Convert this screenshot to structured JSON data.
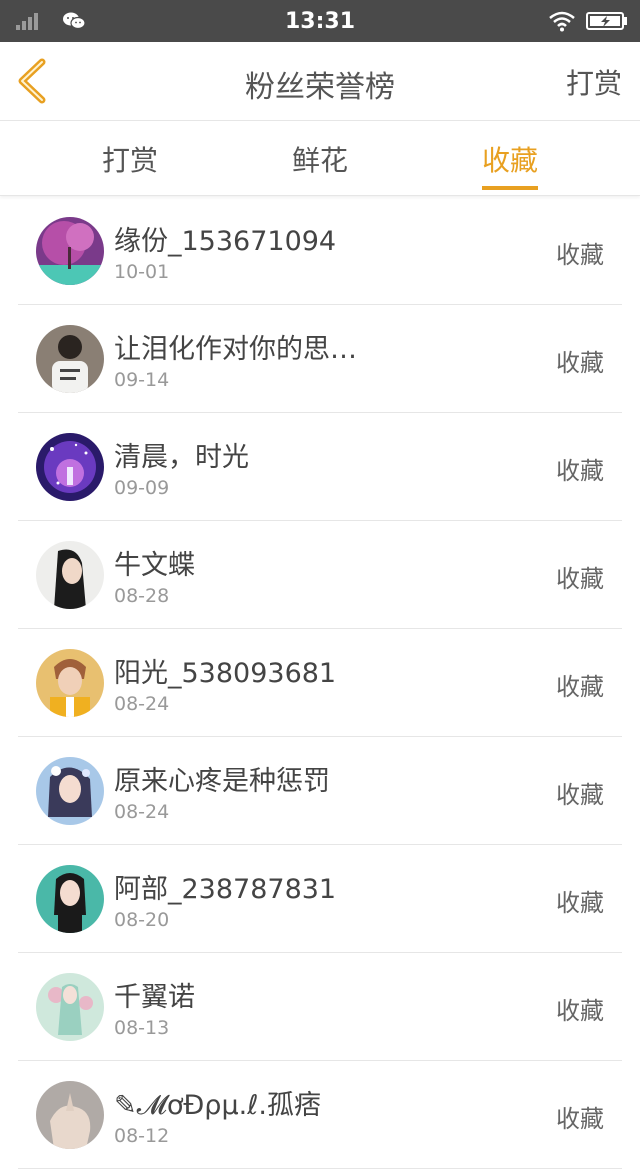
{
  "status_bar": {
    "time": "13:31"
  },
  "header": {
    "title": "粉丝荣誉榜",
    "right_action": "打赏"
  },
  "tabs": [
    {
      "label": "打赏",
      "active": false
    },
    {
      "label": "鲜花",
      "active": false
    },
    {
      "label": "收藏",
      "active": true
    }
  ],
  "colors": {
    "accent": "#e8a021",
    "status_bar": "#4a4a4a"
  },
  "entries": [
    {
      "name": "缘份_153671094",
      "date": "10-01",
      "action": "收藏"
    },
    {
      "name": "让泪化作对你的思…",
      "date": "09-14",
      "action": "收藏"
    },
    {
      "name": "清晨，时光",
      "date": "09-09",
      "action": "收藏"
    },
    {
      "name": "牛文蝶",
      "date": "08-28",
      "action": "收藏"
    },
    {
      "name": "阳光_538093681",
      "date": "08-24",
      "action": "收藏"
    },
    {
      "name": "原来心疼是种惩罚",
      "date": "08-24",
      "action": "收藏"
    },
    {
      "name": "阿部_238787831",
      "date": "08-20",
      "action": "收藏"
    },
    {
      "name": "千翼诺",
      "date": "08-13",
      "action": "收藏"
    },
    {
      "name": "✎𝓜ơĐρµ.ℓ.孤痞",
      "date": "08-12",
      "action": "收藏"
    }
  ]
}
